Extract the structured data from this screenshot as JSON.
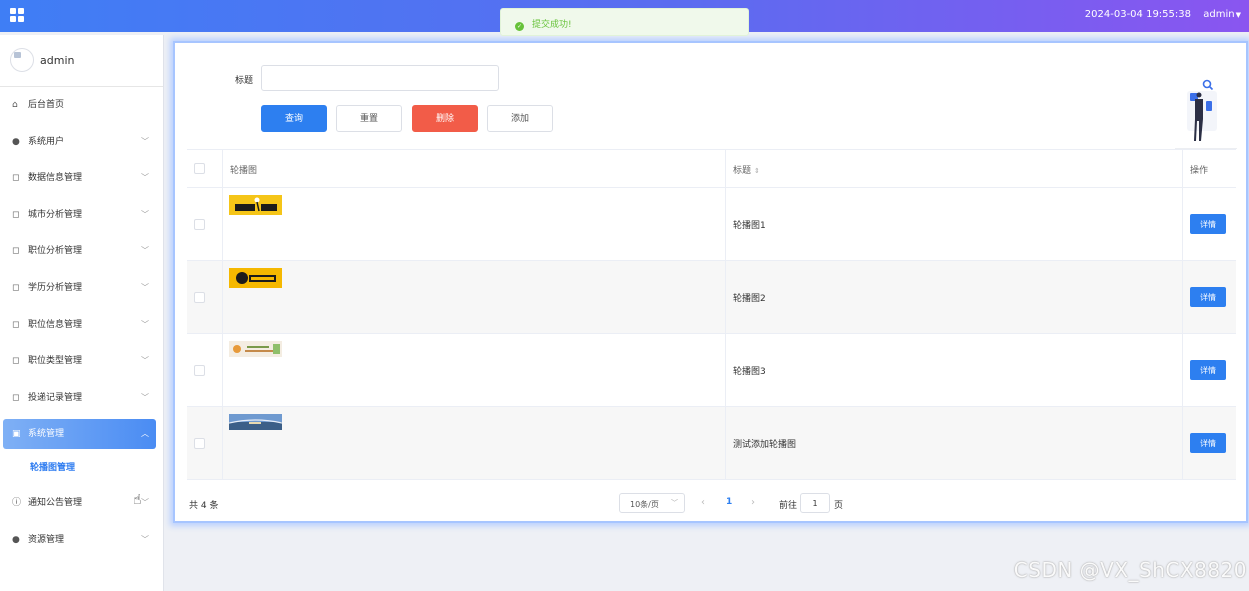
{
  "header": {
    "datetime": "2024-03-04 19:55:38",
    "user": "admin"
  },
  "toast": {
    "message": "提交成功!",
    "color": "#67c23a"
  },
  "sidebar": {
    "username": "admin",
    "items": [
      {
        "label": "后台首页",
        "icon": "home-icon"
      },
      {
        "label": "系统用户",
        "icon": "user-icon"
      },
      {
        "label": "数据信息管理",
        "icon": "square-icon"
      },
      {
        "label": "城市分析管理",
        "icon": "square-icon"
      },
      {
        "label": "职位分析管理",
        "icon": "square-icon"
      },
      {
        "label": "学历分析管理",
        "icon": "square-icon"
      },
      {
        "label": "职位信息管理",
        "icon": "square-icon"
      },
      {
        "label": "职位类型管理",
        "icon": "square-icon"
      },
      {
        "label": "投递记录管理",
        "icon": "square-icon"
      },
      {
        "label": "系统管理",
        "icon": "picture-icon"
      },
      {
        "label": "轮播图管理",
        "icon": ""
      },
      {
        "label": "通知公告管理",
        "icon": "info-icon"
      },
      {
        "label": "资源管理",
        "icon": "location-icon"
      }
    ]
  },
  "search": {
    "label": "标题",
    "value": "",
    "buttons": {
      "query": "查询",
      "reset": "重置",
      "delete": "删除",
      "add": "添加"
    }
  },
  "table": {
    "columns": [
      "轮播图",
      "标题",
      "操作"
    ],
    "rows": [
      {
        "title": "轮播图1",
        "action": "详情"
      },
      {
        "title": "轮播图2",
        "action": "详情"
      },
      {
        "title": "轮播图3",
        "action": "详情"
      },
      {
        "title": "测试添加轮播图",
        "action": "详情"
      }
    ]
  },
  "pagination": {
    "total": "共 4 条",
    "page_size": "10条/页",
    "current_page": "1",
    "goto_label": "前往",
    "goto_value": "1",
    "page_unit": "页"
  },
  "watermark": "CSDN @VX_ShCX8820",
  "colors": {
    "primary": "#2d7ff0",
    "danger": "#f25c48",
    "success": "#67c23a"
  }
}
